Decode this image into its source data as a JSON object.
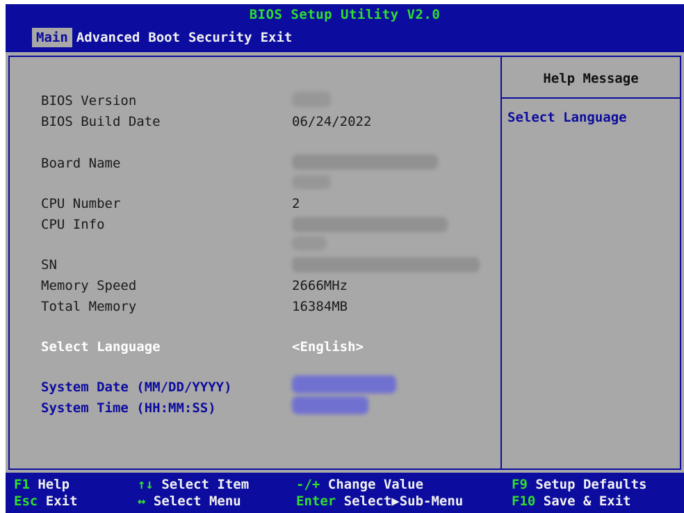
{
  "title": "BIOS Setup Utility V2.0",
  "menu": [
    "Main",
    "Advanced",
    "Boot",
    "Security",
    "Exit"
  ],
  "main_fields": [
    {
      "label": "BIOS Version",
      "value": ""
    },
    {
      "label": "BIOS Build Date",
      "value": "06/24/2022"
    },
    {
      "label": "Board Name",
      "value": ""
    },
    {
      "label": "CPU Number",
      "value": "2"
    },
    {
      "label": "CPU Info",
      "value": ""
    },
    {
      "label": "SN",
      "value": ""
    },
    {
      "label": "Memory Speed",
      "value": "2666MHz"
    },
    {
      "label": "Total Memory",
      "value": "16384MB"
    },
    {
      "label": "Select Language",
      "value": "<English>"
    },
    {
      "label": "System Date (MM/DD/YYYY)",
      "value": ""
    },
    {
      "label": "System Time (HH:MM:SS)",
      "value": ""
    }
  ],
  "help": {
    "title": "Help Message",
    "text": "Select Language"
  },
  "footer": [
    {
      "key": "F1",
      "desc": "Help"
    },
    {
      "key": "Esc",
      "desc": "Exit"
    },
    {
      "key": "↑↓",
      "desc": "Select Item"
    },
    {
      "key": "↔",
      "desc": "Select Menu"
    },
    {
      "key": "-/+",
      "desc": "Change Value"
    },
    {
      "key": "Enter",
      "desc": "Select▶Sub-Menu"
    },
    {
      "key": "F9",
      "desc": "Setup Defaults"
    },
    {
      "key": "F10",
      "desc": "Save & Exit"
    }
  ],
  "colors": {
    "background": "#a8a8a8",
    "bar": "#0c0c9e",
    "title_green": "#2ee02e",
    "selected_text": "#ffffff"
  }
}
